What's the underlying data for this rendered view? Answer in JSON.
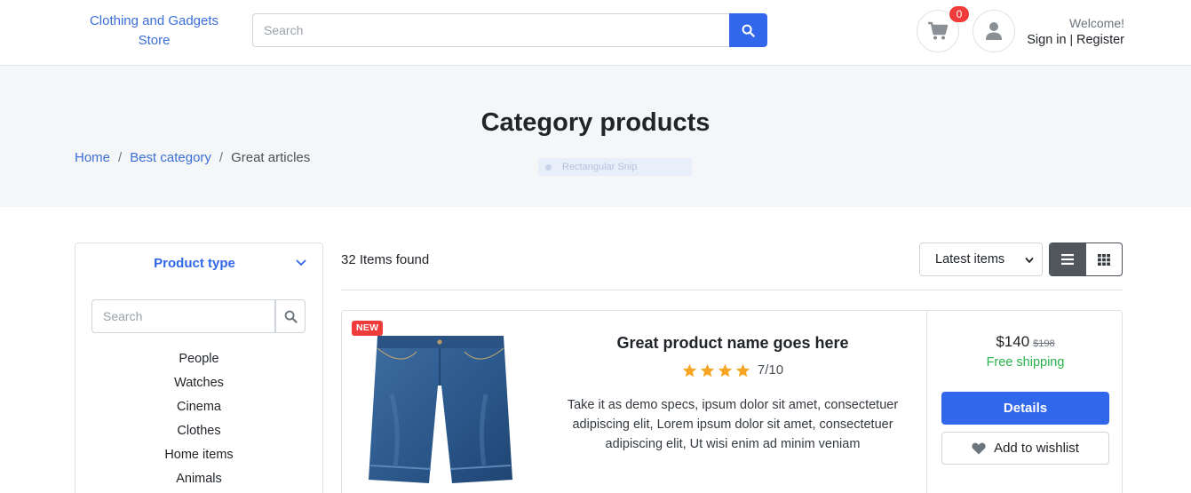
{
  "header": {
    "logo_text": "Clothing and Gadgets Store",
    "search_placeholder": "Search",
    "cart_count": "0",
    "welcome": "Welcome!",
    "sign_in": "Sign in",
    "separator": "|",
    "register": "Register"
  },
  "banner": {
    "title": "Category products",
    "breadcrumb": [
      "Home",
      "Best category",
      "Great articles"
    ],
    "breadcrumb_separator": "/",
    "overlay_tooltip": "Rectangular Snip"
  },
  "sidebar": {
    "filter_title": "Product type",
    "search_placeholder": "Search",
    "categories": [
      "People",
      "Watches",
      "Cinema",
      "Clothes",
      "Home items",
      "Animals"
    ]
  },
  "toolbar": {
    "items_found": "32 Items found",
    "sort_selected": "Latest items",
    "view_mode": "list"
  },
  "product": {
    "badge": "NEW",
    "name": "Great product name goes here",
    "rating": "7/10",
    "stars": 4,
    "description": "Take it as demo specs, ipsum dolor sit amet, consectetuer adipiscing elit, Lorem ipsum dolor sit amet, consectetuer adipiscing elit, Ut wisi enim ad minim veniam",
    "price": "$140",
    "old_price": "$198",
    "shipping": "Free shipping",
    "details_label": "Details",
    "wishlist_label": "Add to wishlist"
  },
  "colors": {
    "primary": "#3167eb",
    "link": "#3b6fd8",
    "badge": "#f03b3b",
    "success": "#2bb24c",
    "star": "#f6a623",
    "banner_bg": "#f5f6f8"
  },
  "icons": [
    "search-icon",
    "cart-icon",
    "user-icon",
    "chevron-down-icon",
    "list-view-icon",
    "grid-view-icon",
    "star-icon",
    "heart-icon"
  ]
}
